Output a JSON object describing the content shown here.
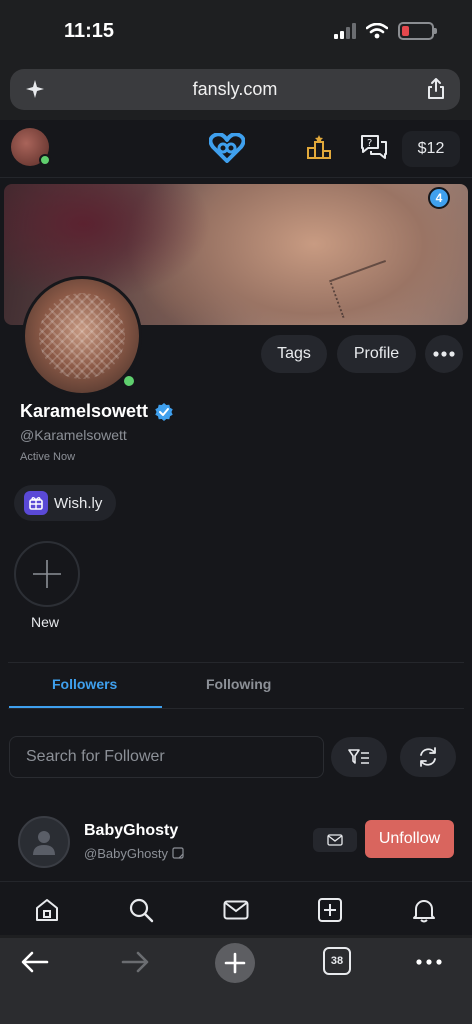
{
  "status_bar": {
    "time": "11:15"
  },
  "browser": {
    "url": "fansly.com",
    "tab_count": "38"
  },
  "nav": {
    "balance": "$12"
  },
  "profile": {
    "display_name": "Karamelsowett",
    "handle": "@Karamelsowett",
    "status": "Active Now",
    "buttons": {
      "tags": "Tags",
      "profile": "Profile"
    },
    "wishlist_label": "Wish.ly",
    "new_label": "New"
  },
  "tabs": {
    "followers": "Followers",
    "following": "Following"
  },
  "search": {
    "placeholder": "Search for Follower"
  },
  "followers": [
    {
      "name": "BabyGhosty",
      "handle": "@BabyGhosty",
      "action": "Unfollow"
    }
  ],
  "notifications_badge": "4",
  "colors": {
    "accent": "#3fa0ee",
    "unfollow": "#d9655e",
    "online": "#5fcf6e",
    "logo": "#3fa0ee",
    "trophy": "#e2a93b"
  }
}
